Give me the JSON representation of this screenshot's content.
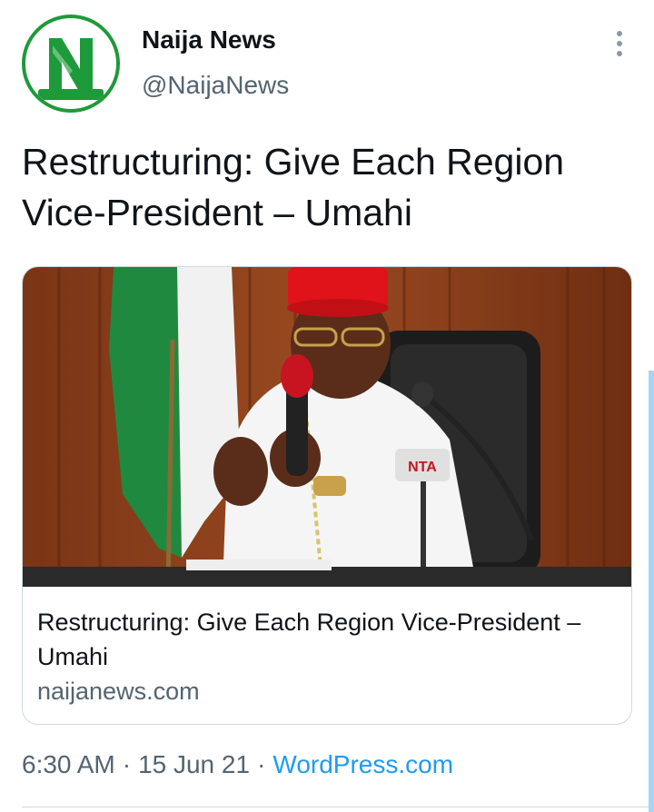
{
  "tweet": {
    "author": {
      "display_name": "Naija News",
      "handle": "@NaijaNews",
      "avatar_logo_text": "NaijaNews"
    },
    "text": "Restructuring: Give Each Region Vice-President – Umahi",
    "card": {
      "title": "Restructuring: Give Each Region Vice-President – Umahi",
      "domain": "naijanews.com",
      "image_icon": "photo-man-speaking-at-microphones",
      "image_sign_text": "NTA"
    },
    "meta": {
      "time": "6:30 AM",
      "separator": "·",
      "date": "15 Jun 21",
      "source": "WordPress.com"
    }
  },
  "icons": {
    "more": "more-vertical-icon"
  },
  "colors": {
    "text_primary": "#0f1419",
    "text_secondary": "#536471",
    "link": "#1d9bf0",
    "brand_green": "#1d9a3a",
    "border": "#cfd9de"
  }
}
